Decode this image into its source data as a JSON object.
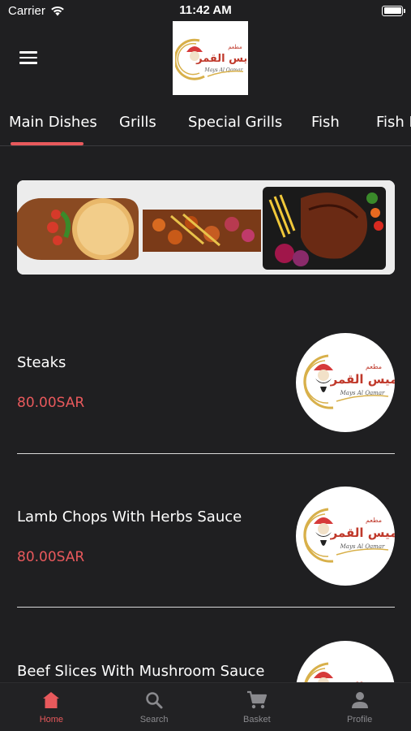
{
  "status": {
    "carrier": "Carrier",
    "time": "11:42 AM"
  },
  "header": {
    "logo_text_ar": "ميس القمر",
    "logo_text_small": "مطعم",
    "logo_text_en": "Mays Al Qamar"
  },
  "tabs": [
    {
      "label": "Main Dishes",
      "active": true
    },
    {
      "label": "Grills"
    },
    {
      "label": "Special Grills"
    },
    {
      "label": "Fish"
    },
    {
      "label": "Fish E"
    }
  ],
  "items": [
    {
      "name": "Steaks",
      "price": "80.00SAR"
    },
    {
      "name": "Lamb Chops With Herbs Sauce",
      "price": "80.00SAR"
    },
    {
      "name": "Beef Slices With Mushroom Sauce",
      "price": ""
    }
  ],
  "nav": [
    {
      "label": "Home",
      "icon": "home-icon",
      "active": true
    },
    {
      "label": "Search",
      "icon": "search-icon"
    },
    {
      "label": "Basket",
      "icon": "cart-icon"
    },
    {
      "label": "Profile",
      "icon": "profile-icon"
    }
  ],
  "colors": {
    "background": "#1f1f21",
    "accent": "#e8595c",
    "inactive_nav": "#8a8a8e"
  }
}
